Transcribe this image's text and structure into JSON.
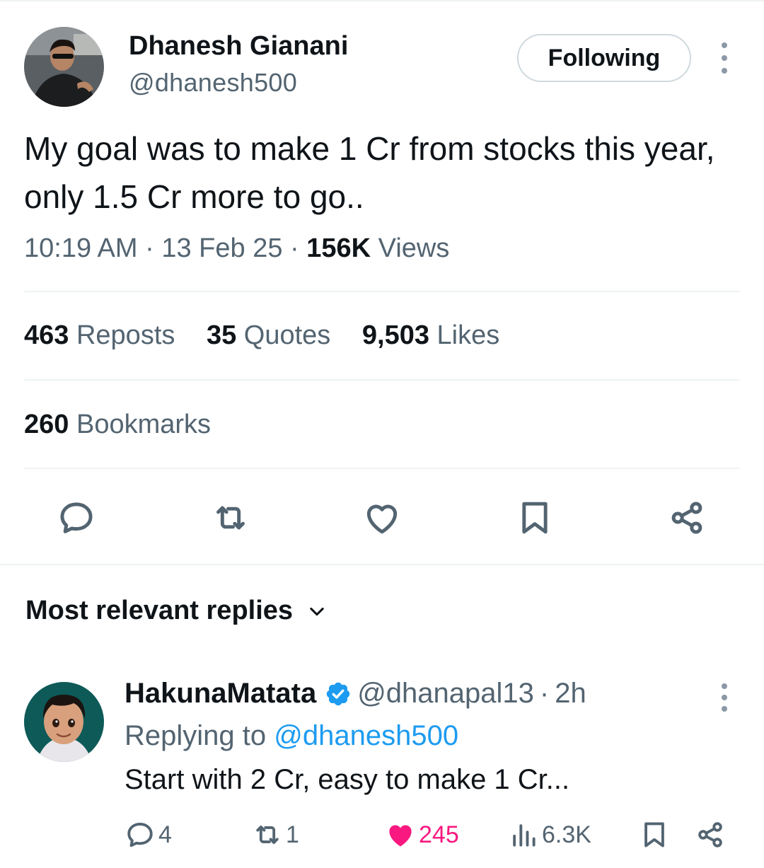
{
  "tweet": {
    "author_name": "Dhanesh Gianani",
    "author_handle": "@dhanesh500",
    "follow_label": "Following",
    "text": "My goal was to make 1 Cr from stocks this year, only 1.5 Cr more to go..",
    "time": "10:19 AM",
    "date": "13 Feb 25",
    "views_count": "156K",
    "views_label": "Views",
    "separator": "·"
  },
  "stats": {
    "reposts_count": "463",
    "reposts_label": "Reposts",
    "quotes_count": "35",
    "quotes_label": "Quotes",
    "likes_count": "9,503",
    "likes_label": "Likes",
    "bookmarks_count": "260",
    "bookmarks_label": "Bookmarks"
  },
  "actions": {
    "icons": [
      "reply-icon",
      "repost-icon",
      "like-icon",
      "bookmark-icon",
      "share-icon"
    ]
  },
  "replies_section": {
    "heading": "Most relevant replies"
  },
  "reply": {
    "author_name": "HakunaMatata",
    "author_handle": "@dhanapal13",
    "time": "2h",
    "separator": "·",
    "replying_prefix": "Replying to",
    "replying_to": "@dhanesh500",
    "text": "Start with 2 Cr, easy to make 1 Cr...",
    "replies_count": "4",
    "reposts_count": "1",
    "likes_count": "245",
    "views_count": "6.3K"
  },
  "colors": {
    "accent": "#1d9bf0",
    "like": "#f91880",
    "muted_text": "#536471",
    "primary_text": "#0f1419",
    "divider": "#eff3f4"
  }
}
